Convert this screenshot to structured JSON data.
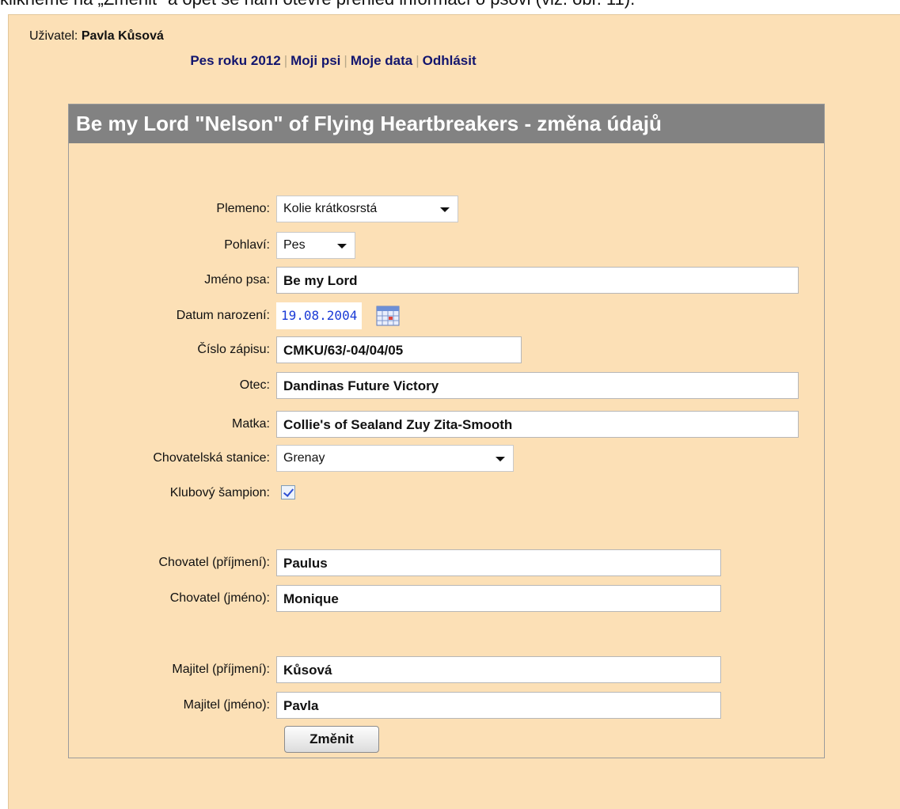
{
  "caption": "klikneme na „Změnit\" a opět se nám otevře přehled informací o psovi (viz. obr. 11).",
  "user": {
    "label": "Uživatel:",
    "name": "Pavla Kůsová"
  },
  "nav": {
    "items": [
      "Pes roku 2012",
      "Moji psi",
      "Moje data",
      "Odhlásit"
    ]
  },
  "panel_title": "Be my Lord \"Nelson\" of Flying Heartbreakers - změna údajů",
  "form": {
    "plemeno": {
      "label": "Plemeno:",
      "value": "Kolie krátkosrstá"
    },
    "pohlavi": {
      "label": "Pohlaví:",
      "value": "Pes"
    },
    "jmeno_psa": {
      "label": "Jméno psa:",
      "value": "Be my Lord"
    },
    "datum": {
      "label": "Datum narození:",
      "value": "19.08.2004"
    },
    "cislo_zapisu": {
      "label": "Číslo zápisu:",
      "value": "CMKU/63/-04/04/05"
    },
    "otec": {
      "label": "Otec:",
      "value": "Dandinas Future Victory"
    },
    "matka": {
      "label": "Matka:",
      "value": "Collie's of Sealand Zuy Zita-Smooth"
    },
    "stanice": {
      "label": "Chovatelská stanice:",
      "value": "Grenay"
    },
    "sampion": {
      "label": "Klubový šampion:",
      "checked": true
    },
    "chovatel_prijmeni": {
      "label": "Chovatel (příjmení):",
      "value": "Paulus"
    },
    "chovatel_jmeno": {
      "label": "Chovatel (jméno):",
      "value": "Monique"
    },
    "majitel_prijmeni": {
      "label": "Majitel (příjmení):",
      "value": "Kůsová"
    },
    "majitel_jmeno": {
      "label": "Majitel (jméno):",
      "value": "Pavla"
    },
    "submit": "Změnit"
  },
  "colors": {
    "page_bg": "#fce0b6",
    "title_bar": "#828282",
    "nav_link": "#12156e",
    "date_text": "#1a3ad6"
  },
  "icons": {
    "calendar": "calendar-icon",
    "dropdown": "chevron-down-icon"
  }
}
